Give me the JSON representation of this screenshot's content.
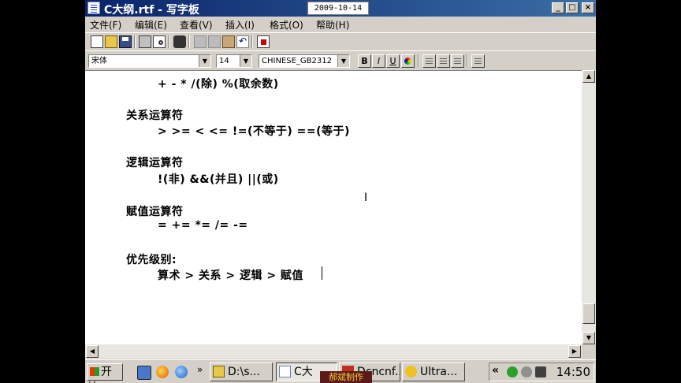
{
  "window": {
    "title": "C大纲.rtf - 写字板",
    "date_stamp": "2009-10-14",
    "minimize_glyph": "_",
    "maximize_glyph": "□",
    "close_glyph": "×"
  },
  "menu": [
    "文件(F)",
    "编辑(E)",
    "查看(V)",
    "插入(I)",
    "格式(O)",
    "帮助(H)"
  ],
  "toolbar_icons": [
    "new-icon",
    "open-icon",
    "save-icon",
    "print-icon",
    "print-preview-icon",
    "find-icon",
    "cut-icon",
    "copy-icon",
    "paste-icon",
    "undo-icon",
    "insert-object-icon"
  ],
  "format_bar": {
    "font": "宋体",
    "size": "14",
    "script": "CHINESE_GB2312",
    "bold": "B",
    "italic": "I",
    "underline": "U",
    "drop_glyph": "▼"
  },
  "document": {
    "lines": [
      "+   -   *   /(除)   %(取余数)",
      "关系运算符",
      ">   >=  <   <=   !=(不等于)   ==(等于)",
      "逻辑运算符",
      "!(非)  &&(并且) ||(或)",
      "赋值运算符",
      "=   +=   *=   /=   -=",
      "优先级别:",
      "算术 > 关系 > 逻辑 > 赋值"
    ],
    "cursor_glyph": "I"
  },
  "scroll": {
    "up": "▲",
    "down": "▼",
    "left": "◀",
    "right": "▶"
  },
  "taskbar": {
    "start": "开始",
    "quicklaunch_more": "»",
    "tasks": [
      "D:\\s...",
      "C大",
      "Dcncnf...",
      "Ultra..."
    ],
    "watermark": "郝斌制作",
    "tray_arrow": "«",
    "clock": "14:50"
  },
  "colors": {
    "titlebar_start": "#0a246a",
    "titlebar_end": "#3a6ea5",
    "chrome": "#d4d0c8"
  }
}
